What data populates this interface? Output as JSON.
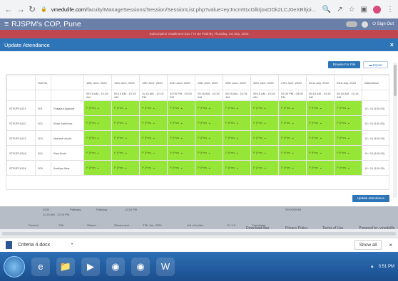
{
  "browser": {
    "url_domain": "vmedulife.com",
    "url_path": "/faculty/ManageSessions/Session/SessionList.php?value=eyJncm91cGlkIjoxODk2LCJ0eXBlIjoi...",
    "extension_label": "!"
  },
  "app": {
    "title": "RJSPM's COP, Pune",
    "signout_label": "Sign Out"
  },
  "banner": {
    "text": "Subscription Installment Due / To Be Paid By Thursday, 1st Sep, 2022"
  },
  "modal": {
    "title": "Update Attendance",
    "close_label": "×",
    "browse_label": "Browse For File",
    "export_label": "Export",
    "update_label": "Update Attendance"
  },
  "grid": {
    "roll_header": "Roll No.",
    "attendance_header": "Attendance",
    "dates": [
      {
        "date": "18th June, 2020",
        "time": "09:15 AM - 10:15 AM"
      },
      {
        "date": "19th June, 2020",
        "time": "09:15 AM - 10:15 AM"
      },
      {
        "date": "19th June, 2020",
        "time": "11:15 AM - 12:15 PM"
      },
      {
        "date": "20th June, 2020",
        "time": "02:00 PM - 03:00 PM"
      },
      {
        "date": "25th June, 2020",
        "time": "09:15 AM - 10:15 AM"
      },
      {
        "date": "26th June, 2020",
        "time": "09:15 AM - 10:15 AM"
      },
      {
        "date": "26th June, 2020",
        "time": "09:15 AM - 10:15 AM"
      },
      {
        "date": "27th June, 2020",
        "time": "02:00 PM - 03:00 PM"
      },
      {
        "date": "02nd July, 2020",
        "time": "09:15 AM - 10:15 AM"
      },
      {
        "date": "03rd July, 2020",
        "time": "09:15 AM - 10:15 AM"
      }
    ],
    "cell_value": "P (Pres",
    "rows": [
      {
        "id": "STRJP11021",
        "roll": "301",
        "name": "Prajakta Agarkar",
        "attendance": "10 / 10 (100.00)"
      },
      {
        "id": "STRJP11022",
        "roll": "302",
        "name": "Kiran Ambhore",
        "attendance": "10 / 10 (100.00)"
      },
      {
        "id": "STRJP11023",
        "roll": "303",
        "name": "Mahesh Anole",
        "attendance": "10 / 10 (100.00)"
      },
      {
        "id": "STRJP10240",
        "roll": "304",
        "name": "Ravi Atole",
        "attendance": "10 / 10 (100.00)"
      },
      {
        "id": "STRJP11024",
        "roll": "305",
        "name": "Arshiya Attar",
        "attendance": "10 / 10 (100.00)"
      }
    ]
  },
  "background": {
    "cells": [
      "2020",
      "11:15 AM - 12:15 PM",
      "Pathway",
      "Pathway",
      "12:15 PM",
      "SHODEKAR",
      "Present",
      "78A",
      "Stream",
      "Stream and",
      "27th Jun, 2020",
      "List of invites",
      "11 / 12",
      "Completed",
      "Download App",
      "Privacy Policy",
      "Terms of Use",
      "Powered by: vmedulife"
    ]
  },
  "downloads": {
    "file_name": "Criteria 4.docx",
    "show_all_label": "Show all"
  },
  "taskbar": {
    "time": "3:51 PM"
  }
}
